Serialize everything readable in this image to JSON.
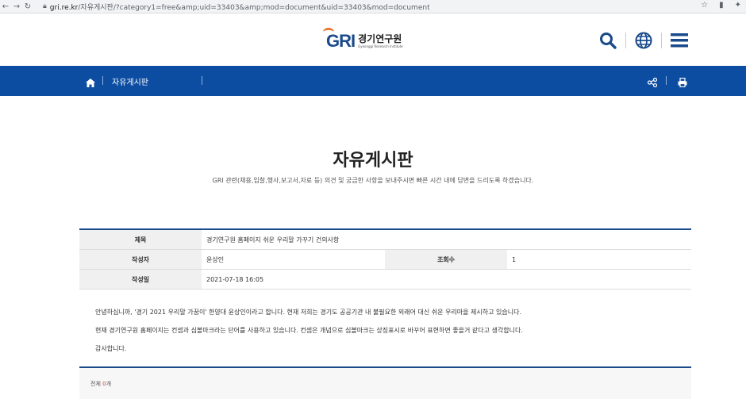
{
  "browser": {
    "url_host": "gri.re.kr",
    "url_path": "/자유게시판/?category1=free&amp;uid=33403&amp;mod=document&uid=33403&mod=document"
  },
  "header": {
    "logo_mark": "GRI",
    "logo_ko": "경기연구원",
    "logo_en": "Gyeonggi Research Institute"
  },
  "nav": {
    "breadcrumb": "자유게시판"
  },
  "page": {
    "title": "자유게시판",
    "description": "GRI 관련(채용,입찰,행사,보고서,자료 등) 의견 및 궁금한 사항을 보내주시면 빠른 시간 내에 답변을 드리도록 하겠습니다."
  },
  "post": {
    "subject_label": "제목",
    "subject": "경기연구원 홈페이지 쉬운 우리말 가꾸기 건의사항",
    "author_label": "작성자",
    "author": "윤상인",
    "views_label": "조회수",
    "views": "1",
    "date_label": "작성일",
    "date": "2021-07-18 16:05",
    "body": [
      "안녕하십니까, '경기 2021 우리말 가꿈이' 한양대 윤상인이라고 합니다. 현재 저희는 경기도 공공기관 내 불필요한 외래어 대신 쉬운 우리마을 제시하고 있습니다.",
      "현재 경기연구원 홈페이지는 컨셉과 심볼마크라는 단어를 사용하고 있습니다. 컨셉은 개념으로 심볼마크는 상징표시로 바꾸어 표현하면 좋을거 같다고 생각합니다.",
      "감사합니다."
    ]
  },
  "comments": {
    "label": "전체",
    "count": "0",
    "unit": "개"
  }
}
